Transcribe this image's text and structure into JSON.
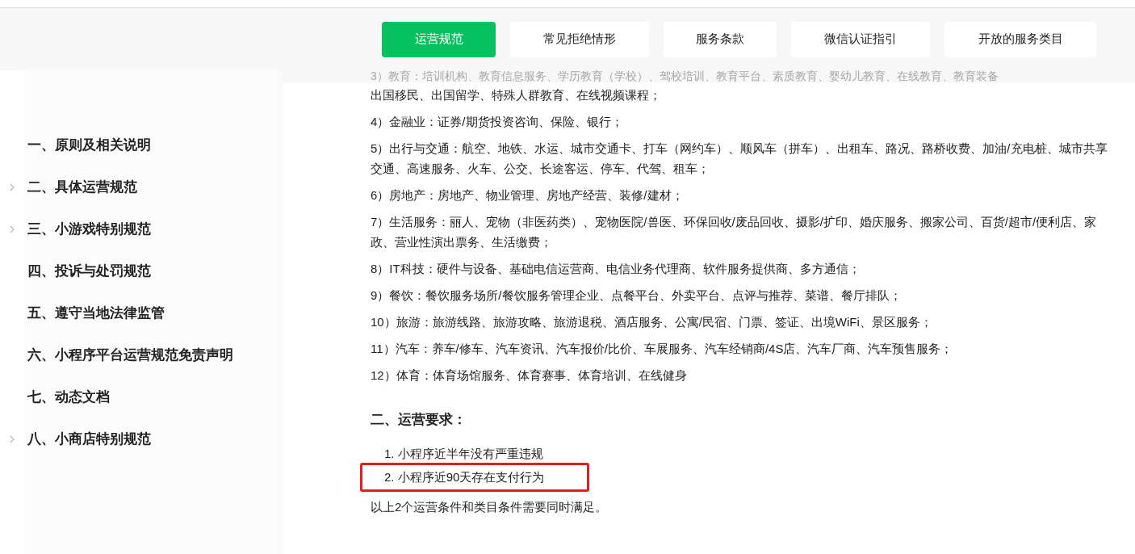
{
  "tabs": [
    {
      "label": "运营规范",
      "selected": true
    },
    {
      "label": "常见拒绝情形",
      "selected": false
    },
    {
      "label": "服务条款",
      "selected": false
    },
    {
      "label": "微信认证指引",
      "selected": false
    },
    {
      "label": "开放的服务类目",
      "selected": false
    }
  ],
  "sidebar": {
    "items": [
      {
        "label": "一、原则及相关说明",
        "expandable": false
      },
      {
        "label": "二、具体运营规范",
        "expandable": true
      },
      {
        "label": "三、小游戏特别规范",
        "expandable": true
      },
      {
        "label": "四、投诉与处罚规范",
        "expandable": false
      },
      {
        "label": "五、遵守当地法律监管",
        "expandable": false
      },
      {
        "label": "六、小程序平台运营规范免责声明",
        "expandable": false
      },
      {
        "label": "七、动态文档",
        "expandable": false
      },
      {
        "label": "八、小商店特别规范",
        "expandable": true
      }
    ]
  },
  "content": {
    "faded_line": "3）教育：培训机构、教育信息服务、学历教育（学校）、驾校培训、教育平台、素质教育、婴幼儿教育、在线教育、教育装备",
    "paragraphs": [
      "出国移民、出国留学、特殊人群教育、在线视频课程；",
      "4）金融业：证券/期货投资咨询、保险、银行；",
      "5）出行与交通：航空、地铁、水运、城市交通卡、打车（网约车）、顺风车（拼车）、出租车、路况、路桥收费、加油/充电桩、城市共享交通、高速服务、火车、公交、长途客运、停车、代驾、租车；",
      "6）房地产：房地产、物业管理、房地产经营、装修/建材；",
      "7）生活服务：丽人、宠物（非医药类）、宠物医院/兽医、环保回收/废品回收、摄影/扩印、婚庆服务、搬家公司、百货/超市/便利店、家政、营业性演出票务、生活缴费；",
      "8）IT科技：硬件与设备、基础电信运营商、电信业务代理商、软件服务提供商、多方通信；",
      "9）餐饮：餐饮服务场所/餐饮服务管理企业、点餐平台、外卖平台、点评与推荐、菜谱、餐厅排队；",
      "10）旅游：旅游线路、旅游攻略、旅游退税、酒店服务、公寓/民宿、门票、签证、出境WiFi、景区服务；",
      "11）汽车：养车/修车、汽车资讯、汽车报价/比价、车展服务、汽车经销商/4S店、汽车厂商、汽车预售服务；",
      "12）体育：体育场馆服务、体育赛事、体育培训、在线健身"
    ],
    "section_heading": "二、运营要求：",
    "requirements": [
      {
        "text": "1. 小程序近半年没有严重违规",
        "highlighted": false
      },
      {
        "text": "2. 小程序近90天存在支付行为",
        "highlighted": true
      }
    ],
    "note": "以上2个运营条件和类目条件需要同时满足。"
  }
}
